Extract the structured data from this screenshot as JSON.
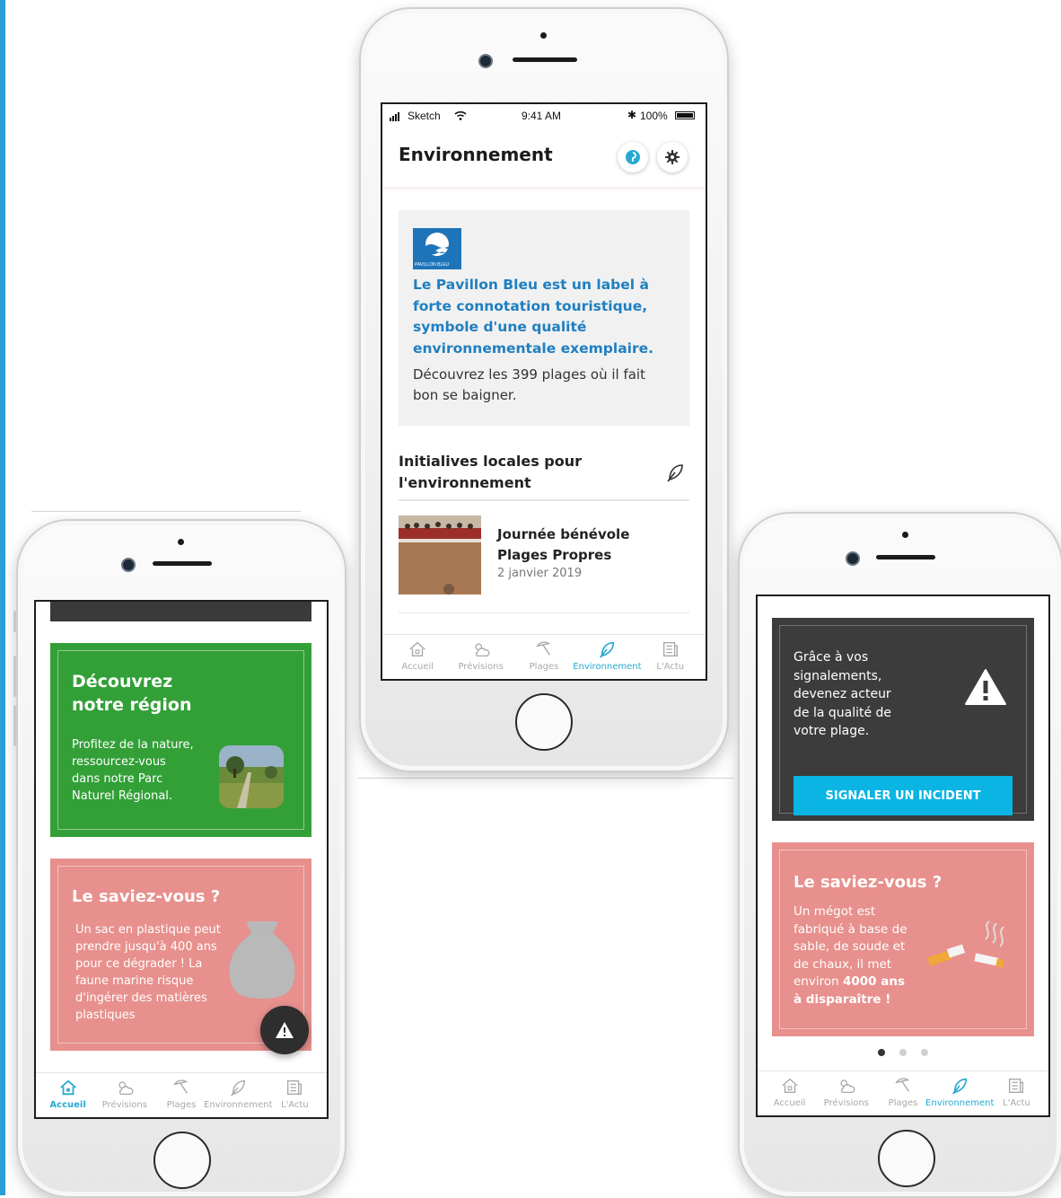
{
  "colors": {
    "accent": "#27a9d1",
    "green_card": "#32a037",
    "pink_card": "#e7908d",
    "dark_card": "#3c3c3c",
    "cta": "#0ab4e3",
    "pavillon_blue": "#1f7fc0"
  },
  "tabs": [
    {
      "label": "Accueil",
      "icon": "home-icon"
    },
    {
      "label": "Prévisions",
      "icon": "weather-icon"
    },
    {
      "label": "Plages",
      "icon": "beach-umbrella-icon"
    },
    {
      "label": "Environnement",
      "icon": "leaf-icon"
    },
    {
      "label": "L'Actu",
      "icon": "news-icon"
    }
  ],
  "left": {
    "active_tab": "Accueil",
    "region_card": {
      "title_line1": "Découvrez",
      "title_line2": "notre région",
      "text_lines": [
        "Profitez de la nature,",
        "ressourcez-vous",
        "dans notre Parc",
        "Naturel Régional."
      ]
    },
    "fact_card": {
      "title": "Le saviez-vous ?",
      "text_lines": [
        "Un sac en plastique peut",
        "prendre jusqu'à 400 ans",
        "pour ce dégrader ! La",
        "faune marine risque",
        "d'ingérer des matières",
        "plastiques"
      ]
    },
    "fab_icon": "warning-icon"
  },
  "center": {
    "status": {
      "carrier": "Sketch",
      "time": "9:41 AM",
      "battery": "100%"
    },
    "header_title": "Environnement",
    "header_buttons": [
      "pin-icon",
      "gear-icon"
    ],
    "pavillon": {
      "logo_text": "PAVILLON BLEU",
      "title_lines": [
        "Le Pavillon Bleu est un label à",
        "forte connotation touristique,",
        "symbole d'une qualité",
        "environnementale exemplaire."
      ],
      "text_lines": [
        "Découvrez les 399 plages où il fait",
        "bon se baigner."
      ]
    },
    "section": {
      "title_line1": "Initialives locales pour",
      "title_line2": "l'environnement",
      "icon": "leaf-icon"
    },
    "news": {
      "title_line1": "Journée bénévole",
      "title_line2": "Plages Propres",
      "date": "2 janvier 2019"
    },
    "active_tab": "Environnement"
  },
  "right": {
    "incident_card": {
      "text_lines": [
        "Grâce à vos",
        "signalements,",
        "devenez acteur",
        "de la qualité de",
        "votre plage."
      ],
      "button_label": "SIGNALER UN INCIDENT",
      "icon": "warning-icon"
    },
    "fact_card": {
      "title": "Le saviez-vous ?",
      "text_lines": [
        "Un mégot est",
        "fabriqué à base de",
        "sable, de soude et",
        "de chaux, il met"
      ],
      "text_prefix": "environ ",
      "text_bold1": "4000 ans",
      "text_bold2": "à disparaître !",
      "icon": "cigarette-icon"
    },
    "pager": {
      "count": 3,
      "active": 1
    },
    "active_tab": "Environnement"
  }
}
